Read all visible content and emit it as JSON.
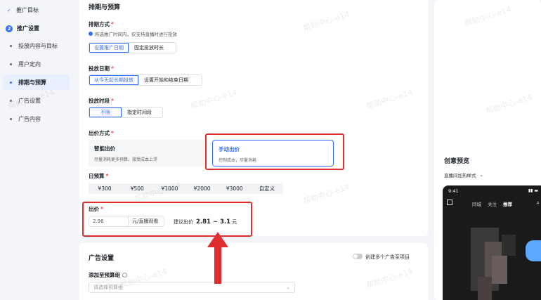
{
  "sidebar": {
    "steps": [
      {
        "label": "推广目标",
        "marker": "✓"
      },
      {
        "label": "推广设置",
        "marker": "2"
      }
    ],
    "items": [
      {
        "label": "投放内容与目标"
      },
      {
        "label": "用户定向"
      },
      {
        "label": "排期与预算"
      },
      {
        "label": "广告设置"
      },
      {
        "label": "广告内容"
      }
    ]
  },
  "schedule": {
    "title": "排期与预算",
    "mode_label": "排期方式",
    "mode_hint": "所选推广时间内，仅支持直播时进行投放",
    "mode_options": [
      "设置推广日期",
      "固定投放时长"
    ],
    "date_label": "投放日期",
    "date_options": [
      "从今天起长期投放",
      "设置开始和结束日期"
    ],
    "time_label": "投放时段",
    "time_options": [
      "不限",
      "指定时间段"
    ],
    "bid_mode_label": "出价方式",
    "bid_modes": [
      {
        "title": "智能出价",
        "desc": "尽量消耗更多预算，接受成本上浮"
      },
      {
        "title": "手动出价",
        "desc": "控制成本，尽量消耗"
      }
    ],
    "budget_label": "日预算",
    "budget_options": [
      "¥300",
      "¥500",
      "¥1000",
      "¥2000",
      "¥3000",
      "自定义"
    ],
    "bid_label": "出价",
    "bid_value": "2.96",
    "bid_unit": "元/直播观看",
    "suggest_prefix": "建议出价",
    "suggest_range": "2.81 ~ 3.1",
    "suggest_unit": "元",
    "required_mark": "*"
  },
  "ad_settings": {
    "title": "广告设置",
    "toggle_label": "创建多个广告至项目",
    "budget_group_label": "添加至预算组",
    "budget_group_placeholder": "请选择预算组"
  },
  "preview": {
    "title": "创意预览",
    "style_select": "直播间加热样式",
    "phone_time": "9:41",
    "phone_tabs": [
      "同城",
      "关注",
      "推荐"
    ]
  },
  "watermark_text": "帮助中心-e14",
  "colors": {
    "accent": "#3370ff",
    "annotation_red": "#e02d2d"
  }
}
